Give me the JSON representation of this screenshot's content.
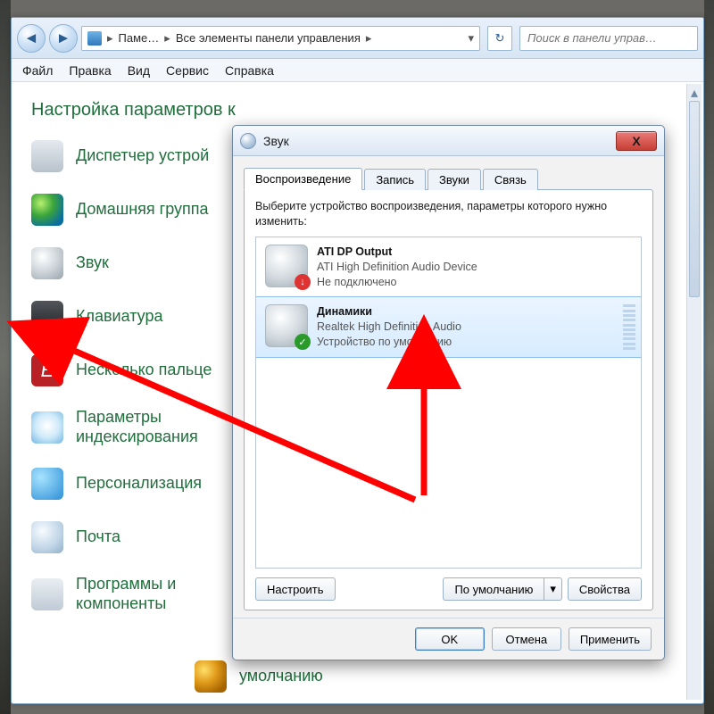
{
  "addressbar": {
    "seg1": "Паме…",
    "seg2": "Все элементы панели управления"
  },
  "search": {
    "placeholder": "Поиск в панели управ…"
  },
  "menubar": {
    "file": "Файл",
    "edit": "Правка",
    "view": "Вид",
    "tools": "Сервис",
    "help": "Справка"
  },
  "heading": "Настройка параметров к",
  "items": {
    "devmgr": "Диспетчер устрой",
    "homegroup": "Домашняя группа",
    "sound": "Звук",
    "keyboard": "Клавиатура",
    "multitouch": "Несколько пальце",
    "indexing_l1": "Параметры",
    "indexing_l2": "индексирования",
    "personalization": "Персонализация",
    "mail": "Почта",
    "programs_l1": "Программы и",
    "programs_l2": "компоненты",
    "defaults": "умолчанию"
  },
  "multitouch_glyph": "E",
  "dialog": {
    "title": "Звук",
    "close": "X",
    "tabs": {
      "playback": "Воспроизведение",
      "recording": "Запись",
      "sounds": "Звуки",
      "comm": "Связь"
    },
    "instruction": "Выберите устройство воспроизведения, параметры которого нужно изменить:",
    "devices": [
      {
        "name": "ATI DP Output",
        "sub": "ATI High Definition Audio Device",
        "state": "Не подключено",
        "selected": false,
        "status": "down"
      },
      {
        "name": "Динамики",
        "sub": "Realtek High Definition Audio",
        "state": "Устройство по умолчанию",
        "selected": true,
        "status": "ok"
      }
    ],
    "buttons": {
      "configure": "Настроить",
      "set_default": "По умолчанию",
      "properties": "Свойства"
    },
    "footer": {
      "ok": "OK",
      "cancel": "Отмена",
      "apply": "Применить"
    },
    "caret": "▾"
  }
}
